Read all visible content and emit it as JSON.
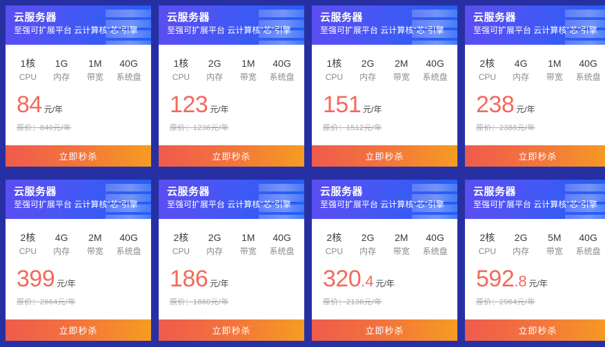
{
  "page": {
    "background_color": "#2730a3",
    "accent_price_color": "#f26a5c",
    "header_gradient_from": "#5a4df0",
    "header_gradient_to": "#2160f7",
    "button_gradient_from": "#ef5b4c",
    "button_gradient_to": "#f59c22"
  },
  "labels": {
    "cpu": "CPU",
    "memory": "内存",
    "bandwidth": "带宽",
    "disk": "系统盘",
    "price_unit": "元/年",
    "buy": "立即秒杀"
  },
  "cards": [
    {
      "title": "云服务器",
      "subtitle": "至强可扩展平台 云计算核\"芯\"引擎",
      "cpu": "1核",
      "memory": "1G",
      "bandwidth": "1M",
      "disk": "40G",
      "price": "84",
      "price_decimal": "",
      "price_unit": "元/年",
      "original_price": "原价：840元/年",
      "buy": "立即秒杀"
    },
    {
      "title": "云服务器",
      "subtitle": "至强可扩展平台 云计算核\"芯\"引擎",
      "cpu": "1核",
      "memory": "2G",
      "bandwidth": "1M",
      "disk": "40G",
      "price": "123",
      "price_decimal": "",
      "price_unit": "元/年",
      "original_price": "原价：1236元/年",
      "buy": "立即秒杀"
    },
    {
      "title": "云服务器",
      "subtitle": "至强可扩展平台 云计算核\"芯\"引擎",
      "cpu": "1核",
      "memory": "2G",
      "bandwidth": "2M",
      "disk": "40G",
      "price": "151",
      "price_decimal": "",
      "price_unit": "元/年",
      "original_price": "原价：1512元/年",
      "buy": "立即秒杀"
    },
    {
      "title": "云服务器",
      "subtitle": "至强可扩展平台 云计算核\"芯\"引擎",
      "cpu": "2核",
      "memory": "4G",
      "bandwidth": "1M",
      "disk": "40G",
      "price": "238",
      "price_decimal": "",
      "price_unit": "元/年",
      "original_price": "原价：2388元/年",
      "buy": "立即秒杀"
    },
    {
      "title": "云服务器",
      "subtitle": "至强可扩展平台 云计算核\"芯\"引擎",
      "cpu": "2核",
      "memory": "4G",
      "bandwidth": "2M",
      "disk": "40G",
      "price": "399",
      "price_decimal": "",
      "price_unit": "元/年",
      "original_price": "原价：2664元/年",
      "buy": "立即秒杀"
    },
    {
      "title": "云服务器",
      "subtitle": "至强可扩展平台 云计算核\"芯\"引擎",
      "cpu": "2核",
      "memory": "2G",
      "bandwidth": "1M",
      "disk": "40G",
      "price": "186",
      "price_decimal": "",
      "price_unit": "元/年",
      "original_price": "原价：1860元/年",
      "buy": "立即秒杀"
    },
    {
      "title": "云服务器",
      "subtitle": "至强可扩展平台 云计算核\"芯\"引擎",
      "cpu": "2核",
      "memory": "2G",
      "bandwidth": "2M",
      "disk": "40G",
      "price": "320",
      "price_decimal": ".4",
      "price_unit": "元/年",
      "original_price": "原价：2136元/年",
      "buy": "立即秒杀"
    },
    {
      "title": "云服务器",
      "subtitle": "至强可扩展平台 云计算核\"芯\"引擎",
      "cpu": "2核",
      "memory": "2G",
      "bandwidth": "5M",
      "disk": "40G",
      "price": "592",
      "price_decimal": ".8",
      "price_unit": "元/年",
      "original_price": "原价：2964元/年",
      "buy": "立即秒杀"
    }
  ]
}
